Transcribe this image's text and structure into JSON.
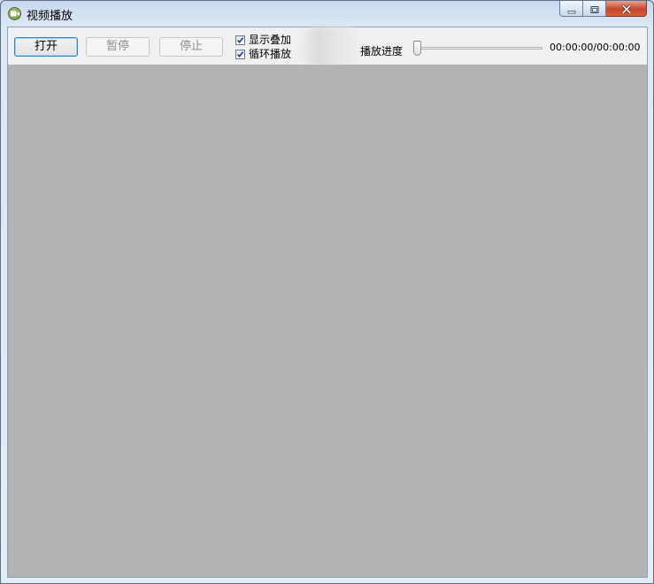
{
  "window": {
    "title": "视频播放"
  },
  "toolbar": {
    "open_label": "打开",
    "pause_label": "暂停",
    "stop_label": "停止",
    "show_overlay": {
      "label": "显示叠加",
      "checked": true
    },
    "loop_play": {
      "label": "循环播放",
      "checked": true
    },
    "progress_label": "播放进度",
    "progress_value": 0,
    "time_display": "00:00:00/00:00:00"
  },
  "colors": {
    "video_background": "#b3b3b3",
    "toolbar_background": "#f0f0f0",
    "close_button": "#c9462c"
  },
  "icons": {
    "app": "video-camera-icon",
    "minimize": "minimize-icon",
    "maximize": "maximize-icon",
    "close": "close-icon"
  }
}
